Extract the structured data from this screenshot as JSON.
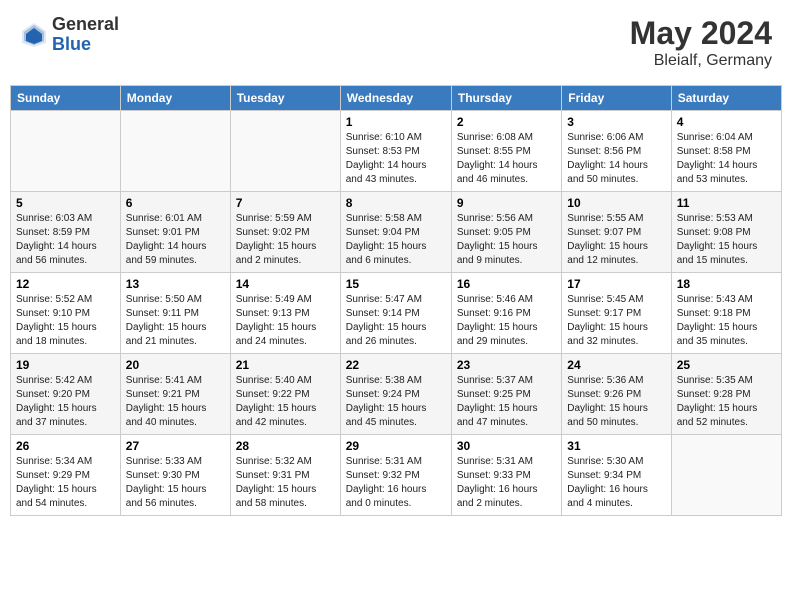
{
  "header": {
    "logo_general": "General",
    "logo_blue": "Blue",
    "title": "May 2024",
    "location": "Bleialf, Germany"
  },
  "weekdays": [
    "Sunday",
    "Monday",
    "Tuesday",
    "Wednesday",
    "Thursday",
    "Friday",
    "Saturday"
  ],
  "weeks": [
    [
      {
        "day": "",
        "info": ""
      },
      {
        "day": "",
        "info": ""
      },
      {
        "day": "",
        "info": ""
      },
      {
        "day": "1",
        "info": "Sunrise: 6:10 AM\nSunset: 8:53 PM\nDaylight: 14 hours\nand 43 minutes."
      },
      {
        "day": "2",
        "info": "Sunrise: 6:08 AM\nSunset: 8:55 PM\nDaylight: 14 hours\nand 46 minutes."
      },
      {
        "day": "3",
        "info": "Sunrise: 6:06 AM\nSunset: 8:56 PM\nDaylight: 14 hours\nand 50 minutes."
      },
      {
        "day": "4",
        "info": "Sunrise: 6:04 AM\nSunset: 8:58 PM\nDaylight: 14 hours\nand 53 minutes."
      }
    ],
    [
      {
        "day": "5",
        "info": "Sunrise: 6:03 AM\nSunset: 8:59 PM\nDaylight: 14 hours\nand 56 minutes."
      },
      {
        "day": "6",
        "info": "Sunrise: 6:01 AM\nSunset: 9:01 PM\nDaylight: 14 hours\nand 59 minutes."
      },
      {
        "day": "7",
        "info": "Sunrise: 5:59 AM\nSunset: 9:02 PM\nDaylight: 15 hours\nand 2 minutes."
      },
      {
        "day": "8",
        "info": "Sunrise: 5:58 AM\nSunset: 9:04 PM\nDaylight: 15 hours\nand 6 minutes."
      },
      {
        "day": "9",
        "info": "Sunrise: 5:56 AM\nSunset: 9:05 PM\nDaylight: 15 hours\nand 9 minutes."
      },
      {
        "day": "10",
        "info": "Sunrise: 5:55 AM\nSunset: 9:07 PM\nDaylight: 15 hours\nand 12 minutes."
      },
      {
        "day": "11",
        "info": "Sunrise: 5:53 AM\nSunset: 9:08 PM\nDaylight: 15 hours\nand 15 minutes."
      }
    ],
    [
      {
        "day": "12",
        "info": "Sunrise: 5:52 AM\nSunset: 9:10 PM\nDaylight: 15 hours\nand 18 minutes."
      },
      {
        "day": "13",
        "info": "Sunrise: 5:50 AM\nSunset: 9:11 PM\nDaylight: 15 hours\nand 21 minutes."
      },
      {
        "day": "14",
        "info": "Sunrise: 5:49 AM\nSunset: 9:13 PM\nDaylight: 15 hours\nand 24 minutes."
      },
      {
        "day": "15",
        "info": "Sunrise: 5:47 AM\nSunset: 9:14 PM\nDaylight: 15 hours\nand 26 minutes."
      },
      {
        "day": "16",
        "info": "Sunrise: 5:46 AM\nSunset: 9:16 PM\nDaylight: 15 hours\nand 29 minutes."
      },
      {
        "day": "17",
        "info": "Sunrise: 5:45 AM\nSunset: 9:17 PM\nDaylight: 15 hours\nand 32 minutes."
      },
      {
        "day": "18",
        "info": "Sunrise: 5:43 AM\nSunset: 9:18 PM\nDaylight: 15 hours\nand 35 minutes."
      }
    ],
    [
      {
        "day": "19",
        "info": "Sunrise: 5:42 AM\nSunset: 9:20 PM\nDaylight: 15 hours\nand 37 minutes."
      },
      {
        "day": "20",
        "info": "Sunrise: 5:41 AM\nSunset: 9:21 PM\nDaylight: 15 hours\nand 40 minutes."
      },
      {
        "day": "21",
        "info": "Sunrise: 5:40 AM\nSunset: 9:22 PM\nDaylight: 15 hours\nand 42 minutes."
      },
      {
        "day": "22",
        "info": "Sunrise: 5:38 AM\nSunset: 9:24 PM\nDaylight: 15 hours\nand 45 minutes."
      },
      {
        "day": "23",
        "info": "Sunrise: 5:37 AM\nSunset: 9:25 PM\nDaylight: 15 hours\nand 47 minutes."
      },
      {
        "day": "24",
        "info": "Sunrise: 5:36 AM\nSunset: 9:26 PM\nDaylight: 15 hours\nand 50 minutes."
      },
      {
        "day": "25",
        "info": "Sunrise: 5:35 AM\nSunset: 9:28 PM\nDaylight: 15 hours\nand 52 minutes."
      }
    ],
    [
      {
        "day": "26",
        "info": "Sunrise: 5:34 AM\nSunset: 9:29 PM\nDaylight: 15 hours\nand 54 minutes."
      },
      {
        "day": "27",
        "info": "Sunrise: 5:33 AM\nSunset: 9:30 PM\nDaylight: 15 hours\nand 56 minutes."
      },
      {
        "day": "28",
        "info": "Sunrise: 5:32 AM\nSunset: 9:31 PM\nDaylight: 15 hours\nand 58 minutes."
      },
      {
        "day": "29",
        "info": "Sunrise: 5:31 AM\nSunset: 9:32 PM\nDaylight: 16 hours\nand 0 minutes."
      },
      {
        "day": "30",
        "info": "Sunrise: 5:31 AM\nSunset: 9:33 PM\nDaylight: 16 hours\nand 2 minutes."
      },
      {
        "day": "31",
        "info": "Sunrise: 5:30 AM\nSunset: 9:34 PM\nDaylight: 16 hours\nand 4 minutes."
      },
      {
        "day": "",
        "info": ""
      }
    ]
  ]
}
